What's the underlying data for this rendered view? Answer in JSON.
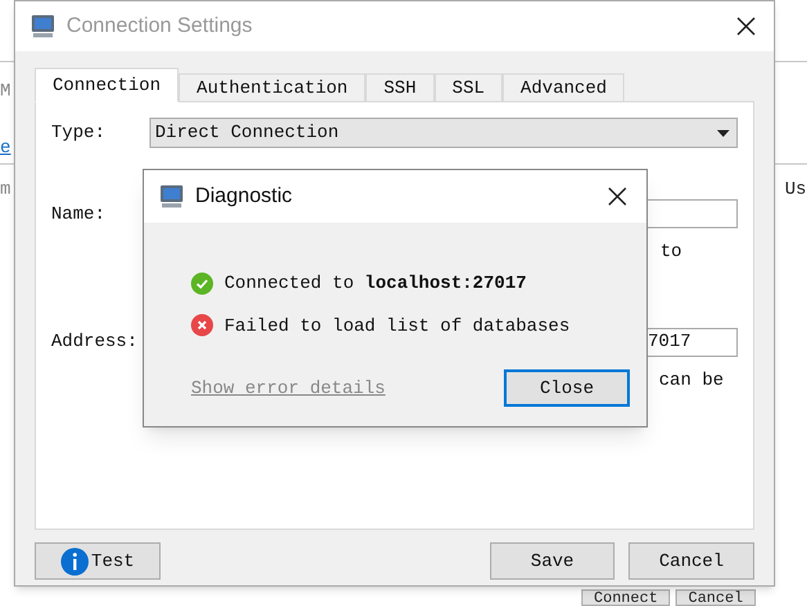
{
  "background_app": {
    "left_texts": [
      {
        "text": "M",
        "kind": "label"
      },
      {
        "text": "e",
        "kind": "link"
      },
      {
        "text": "m",
        "kind": "label"
      }
    ],
    "right_text": "Us",
    "buttons": [
      "Connect",
      "Cancel"
    ]
  },
  "window": {
    "title": "Connection Settings"
  },
  "tabs": [
    {
      "label": "Connection",
      "selected": true
    },
    {
      "label": "Authentication",
      "selected": false
    },
    {
      "label": "SSH",
      "selected": false
    },
    {
      "label": "SSL",
      "selected": false
    },
    {
      "label": "Advanced",
      "selected": false
    }
  ],
  "form": {
    "type_label": "Type:",
    "type_value": "Direct Connection",
    "name_label": "Name:",
    "name_hint": "to",
    "address_label": "Address:",
    "address_value": "7017",
    "address_hint": "can be"
  },
  "buttons": {
    "test": "Test",
    "save": "Save",
    "cancel": "Cancel"
  },
  "diagnostic": {
    "title": "Diagnostic",
    "messages": [
      {
        "kind": "ok",
        "text": "Connected to **localhost:27017**"
      },
      {
        "kind": "error",
        "text": "Failed to load list of databases"
      }
    ],
    "link": "Show error details",
    "close_button": "Close"
  }
}
